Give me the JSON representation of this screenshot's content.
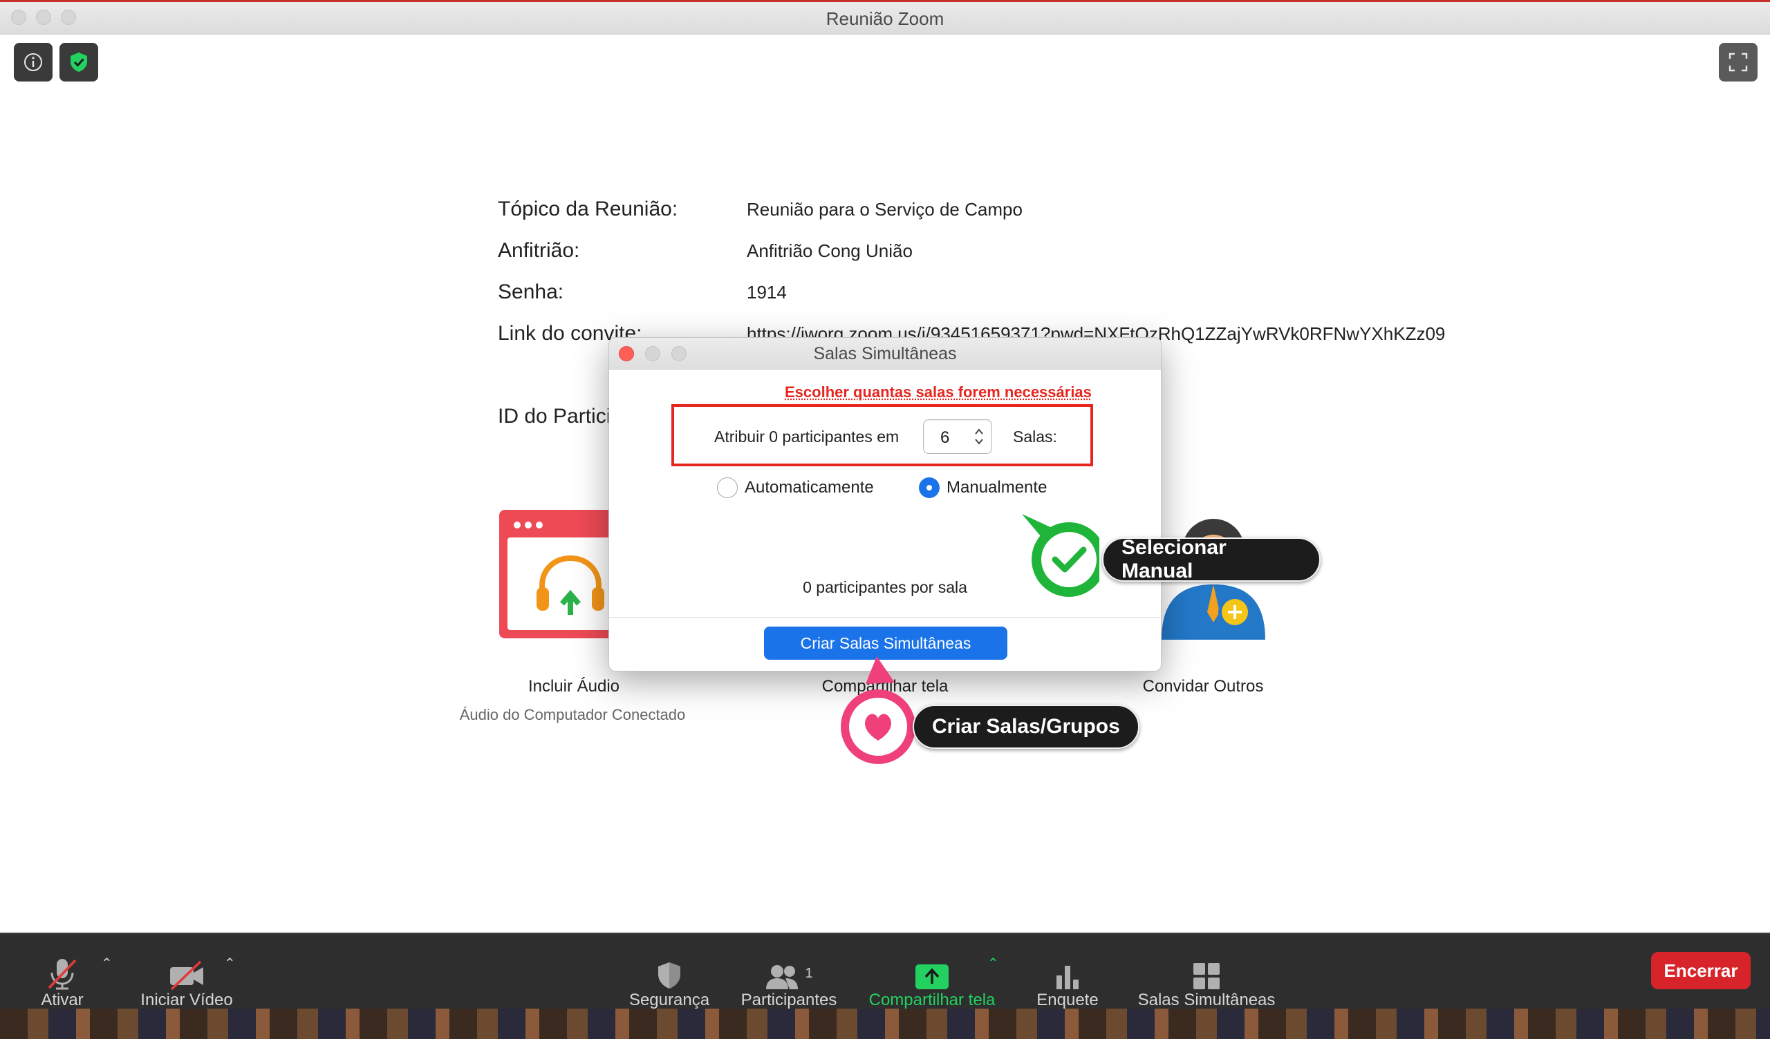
{
  "window": {
    "title": "Reunião Zoom"
  },
  "meeting_info": {
    "topic_label": "Tópico da Reunião:",
    "topic_value": "Reunião para o Serviço de Campo",
    "host_label": "Anfitrião:",
    "host_value": "Anfitrião Cong União",
    "password_label": "Senha:",
    "password_value": "1914",
    "invite_label": "Link do convite:",
    "invite_value": "https://jworg.zoom.us/j/93451659371?pwd=NXFtQzRhQ1ZZajYwRVk0RFNwYXhKZz09",
    "participant_id_label": "ID do Participante:"
  },
  "features": [
    {
      "label": "Incluir Áudio",
      "sub": "Áudio do Computador Conectado"
    },
    {
      "label": "Compartilhar tela"
    },
    {
      "label": "Convidar Outros"
    }
  ],
  "dialog": {
    "title": "Salas Simultâneas",
    "annotation": "Escolher quantas salas forem necessárias",
    "assign_prefix": "Atribuir 0 participantes em",
    "rooms_count": "6",
    "rooms_suffix": "Salas:",
    "option_auto": "Automaticamente",
    "option_manual": "Manualmente",
    "selected_option": "Manualmente",
    "per_room": "0 participantes por sala",
    "create_button": "Criar Salas Simultâneas"
  },
  "callouts": {
    "manual": "Selecionar Manual",
    "create": "Criar Salas/Grupos"
  },
  "toolbar": {
    "mute": "Ativar",
    "video": "Iniciar Vídeo",
    "security": "Segurança",
    "participants": "Participantes",
    "participants_count": "1",
    "share": "Compartilhar tela",
    "poll": "Enquete",
    "breakout": "Salas Simultâneas",
    "end": "Encerrar"
  },
  "colors": {
    "accent_blue": "#1a73e8",
    "share_green": "#23d160",
    "end_red": "#d7242b",
    "annotation_red": "#e6261f",
    "callout_green": "#1fb53a",
    "callout_pink": "#f0407a"
  }
}
